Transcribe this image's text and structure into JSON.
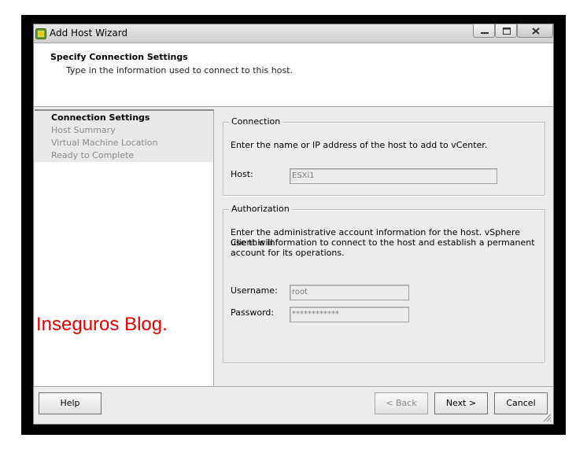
{
  "window": {
    "title": "Add Host Wizard",
    "icon": "vsphere-app-icon"
  },
  "header": {
    "title": "Specify Connection Settings",
    "subtitle": "Type in the information used to connect to this host."
  },
  "steps": [
    {
      "label": "Connection Settings",
      "active": true
    },
    {
      "label": "Host Summary",
      "active": false
    },
    {
      "label": "Virtual Machine Location",
      "active": false
    },
    {
      "label": "Ready to Complete",
      "active": false
    }
  ],
  "watermark": "Inseguros Blog.",
  "connection": {
    "legend": "Connection",
    "description": "Enter the name or IP address of the host to add to vCenter.",
    "host_label": "Host:",
    "host_value": "ESXi1"
  },
  "authorization": {
    "legend": "Authorization",
    "description_lines": [
      "Enter the administrative account information for the host. vSphere Client will",
      "use this information to connect to the host and establish a permanent",
      "account for its operations."
    ],
    "username_label": "Username:",
    "username_value": "root",
    "password_label": "Password:",
    "password_value": "************"
  },
  "buttons": {
    "help": "Help",
    "back": "< Back",
    "next": "Next >",
    "cancel": "Cancel"
  },
  "colors": {
    "watermark": "#e00000",
    "window_bg": "#ececec"
  }
}
